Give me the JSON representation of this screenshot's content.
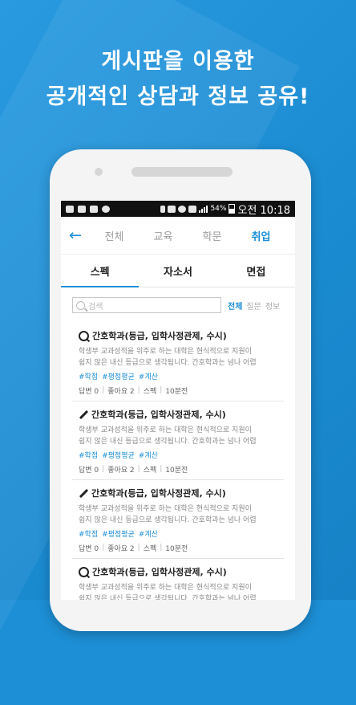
{
  "headline": {
    "line1": "게시판을 이용한",
    "line2": "공개적인 상담과 정보 공유!"
  },
  "status_bar": {
    "battery": "54%",
    "time": "오전 10:18"
  },
  "nav": {
    "back_icon": "arrow-left-icon",
    "categories": [
      "전체",
      "교육",
      "학문",
      "취업"
    ],
    "active_category": "취업"
  },
  "subtabs": {
    "items": [
      "스펙",
      "자소서",
      "면접"
    ],
    "active": "스펙"
  },
  "search": {
    "placeholder": "검색",
    "filters": [
      "전체",
      "질문",
      "정보"
    ],
    "active_filter": "전체"
  },
  "posts": [
    {
      "type_icon": "question-icon",
      "title": "간호학과(등급, 입학사정관제, 수시)",
      "body_line1": "학생부 교과성적을 위주로 하는 대학은 현식적으로 지원이",
      "body_line2": "쉽지 않은 내신 등급으로 생각됩니다. 간호학과는 넘나 어렵",
      "tags": [
        "#학점",
        "#평점평균",
        "#계산"
      ],
      "answers": "답변 0",
      "likes": "좋아요 2",
      "board": "스펙",
      "time": "10분전"
    },
    {
      "type_icon": "pencil-icon",
      "title": "간호학과(등급, 입학사정관제, 수시)",
      "body_line1": "학생부 교과성적을 위주로 하는 대학은 현식적으로 지원이",
      "body_line2": "쉽지 않은 내신 등급으로 생각됩니다. 간호학과는 넘나 어렵",
      "tags": [
        "#학점",
        "#평점평균",
        "#계산"
      ],
      "answers": "답변 0",
      "likes": "좋아요 2",
      "board": "스펙",
      "time": "10분전"
    },
    {
      "type_icon": "pencil-icon",
      "title": "간호학과(등급, 입학사정관제, 수시)",
      "body_line1": "학생부 교과성적을 위주로 하는 대학은 현식적으로 지원이",
      "body_line2": "쉽지 않은 내신 등급으로 생각됩니다. 간호학과는 넘나 어렵",
      "tags": [
        "#학점",
        "#평점평균",
        "#계산"
      ],
      "answers": "답변 0",
      "likes": "좋아요 2",
      "board": "스펙",
      "time": "10분전"
    },
    {
      "type_icon": "question-icon",
      "title": "간호학과(등급, 입학사정관제, 수시)",
      "body_line1": "학생부 교과성적을 위주로 하는 대학은 현식적으로 지원이",
      "body_line2": "쉽지 않은 내신 등급으로 생각됩니다. 간호학과는 넘나 어렵"
    }
  ],
  "colors": {
    "accent": "#1d8fd6",
    "background": "#1d8fd6"
  }
}
